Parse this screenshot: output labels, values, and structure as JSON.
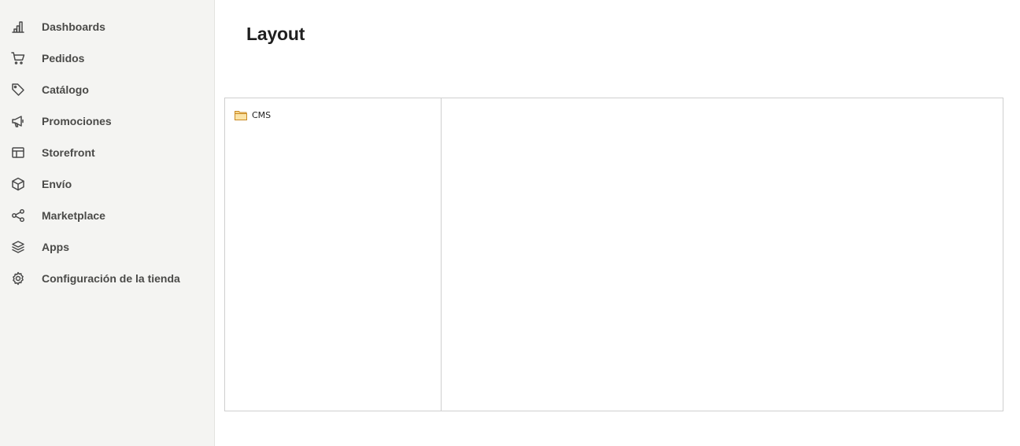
{
  "sidebar": {
    "items": [
      {
        "label": "Dashboards",
        "icon": "bar-chart-icon"
      },
      {
        "label": "Pedidos",
        "icon": "cart-icon"
      },
      {
        "label": "Catálogo",
        "icon": "tag-icon"
      },
      {
        "label": "Promociones",
        "icon": "megaphone-icon"
      },
      {
        "label": "Storefront",
        "icon": "layout-icon"
      },
      {
        "label": "Envío",
        "icon": "box-icon"
      },
      {
        "label": "Marketplace",
        "icon": "share-icon"
      },
      {
        "label": "Apps",
        "icon": "layers-icon"
      },
      {
        "label": "Configuración de la tienda",
        "icon": "gear-icon"
      }
    ]
  },
  "main": {
    "title": "Layout",
    "tree": {
      "nodes": [
        {
          "label": "CMS",
          "icon": "folder-icon"
        }
      ]
    }
  },
  "colors": {
    "sidebar_bg": "#f4f4f2",
    "border": "#cfcfcf",
    "folder": "#e8a93c"
  }
}
